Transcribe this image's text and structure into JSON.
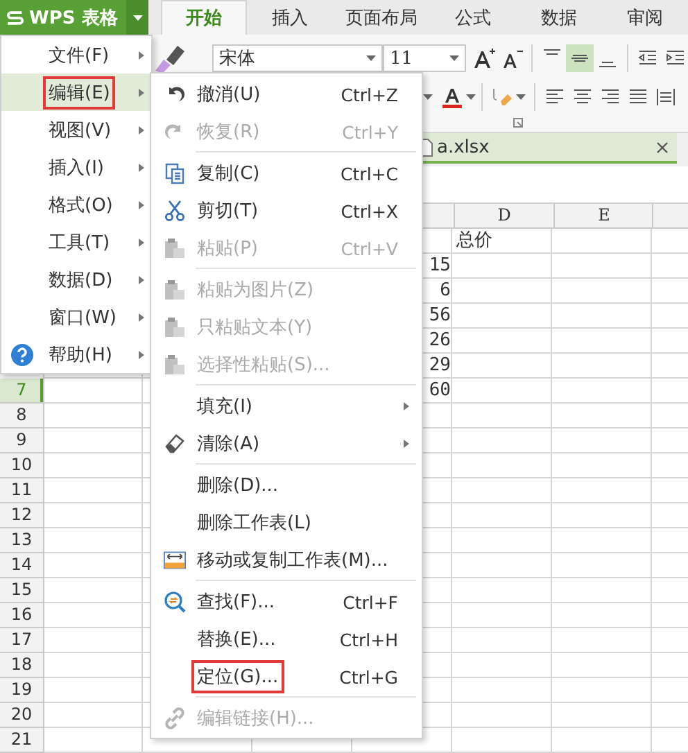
{
  "app_button": {
    "label": "WPS 表格"
  },
  "ribbon_tabs": [
    {
      "label": "开始",
      "selected": true
    },
    {
      "label": "插入",
      "selected": false
    },
    {
      "label": "页面布局",
      "selected": false
    },
    {
      "label": "公式",
      "selected": false
    },
    {
      "label": "数据",
      "selected": false
    },
    {
      "label": "审阅",
      "selected": false
    }
  ],
  "toolbar": {
    "font": "宋体",
    "font_size": "11"
  },
  "document_tab": {
    "title": "a.xlsx"
  },
  "sheet": {
    "column_headers": [
      "D",
      "E"
    ],
    "row_numbers": [
      {
        "label": "7",
        "selected": true
      },
      {
        "label": "8",
        "selected": false
      },
      {
        "label": "9",
        "selected": false
      },
      {
        "label": "10",
        "selected": false
      },
      {
        "label": "11",
        "selected": false
      },
      {
        "label": "12",
        "selected": false
      },
      {
        "label": "13",
        "selected": false
      },
      {
        "label": "14",
        "selected": false
      },
      {
        "label": "15",
        "selected": false
      },
      {
        "label": "16",
        "selected": false
      },
      {
        "label": "17",
        "selected": false
      },
      {
        "label": "18",
        "selected": false
      },
      {
        "label": "19",
        "selected": false
      },
      {
        "label": "20",
        "selected": false
      },
      {
        "label": "21",
        "selected": false
      }
    ],
    "rows": [
      {
        "column_d": "总价"
      },
      {
        "column_c": "15"
      },
      {
        "column_c": "6"
      },
      {
        "column_c": "56"
      },
      {
        "column_c": "26"
      },
      {
        "column_c": "29"
      },
      {
        "column_c": "60"
      }
    ]
  },
  "main_menu": {
    "items": [
      {
        "label": "文件(F)",
        "selected": false,
        "marked": false
      },
      {
        "label": "编辑(E)",
        "selected": true,
        "marked": true
      },
      {
        "label": "视图(V)",
        "selected": false,
        "marked": false
      },
      {
        "label": "插入(I)",
        "selected": false,
        "marked": false
      },
      {
        "label": "格式(O)",
        "selected": false,
        "marked": false
      },
      {
        "label": "工具(T)",
        "selected": false,
        "marked": false
      },
      {
        "label": "数据(D)",
        "selected": false,
        "marked": false
      },
      {
        "label": "窗口(W)",
        "selected": false,
        "marked": false
      },
      {
        "label": "帮助(H)",
        "selected": false,
        "marked": false
      }
    ]
  },
  "edit_menu": {
    "items": [
      {
        "kind": "item",
        "label": "撤消(U)",
        "shortcut": "Ctrl+Z",
        "disabled": false,
        "has_submenu": false,
        "marked": false
      },
      {
        "kind": "item",
        "label": "恢复(R)",
        "shortcut": "Ctrl+Y",
        "disabled": true,
        "has_submenu": false,
        "marked": false
      },
      {
        "kind": "separator"
      },
      {
        "kind": "item",
        "label": "复制(C)",
        "shortcut": "Ctrl+C",
        "disabled": false,
        "has_submenu": false,
        "marked": false
      },
      {
        "kind": "item",
        "label": "剪切(T)",
        "shortcut": "Ctrl+X",
        "disabled": false,
        "has_submenu": false,
        "marked": false
      },
      {
        "kind": "item",
        "label": "粘贴(P)",
        "shortcut": "Ctrl+V",
        "disabled": true,
        "has_submenu": false,
        "marked": false
      },
      {
        "kind": "separator"
      },
      {
        "kind": "item",
        "label": "粘贴为图片(Z)",
        "disabled": true,
        "has_submenu": false,
        "marked": false
      },
      {
        "kind": "item",
        "label": "只粘贴文本(Y)",
        "disabled": true,
        "has_submenu": false,
        "marked": false
      },
      {
        "kind": "item",
        "label": "选择性粘贴(S)...",
        "disabled": true,
        "has_submenu": false,
        "marked": false
      },
      {
        "kind": "separator"
      },
      {
        "kind": "item",
        "label": "填充(I)",
        "disabled": false,
        "has_submenu": true,
        "marked": false
      },
      {
        "kind": "item",
        "label": "清除(A)",
        "disabled": false,
        "has_submenu": true,
        "marked": false
      },
      {
        "kind": "separator"
      },
      {
        "kind": "item",
        "label": "删除(D)...",
        "disabled": false,
        "has_submenu": false,
        "marked": false
      },
      {
        "kind": "item",
        "label": "删除工作表(L)",
        "disabled": false,
        "has_submenu": false,
        "marked": false
      },
      {
        "kind": "item",
        "label": "移动或复制工作表(M)...",
        "disabled": false,
        "has_submenu": false,
        "marked": false
      },
      {
        "kind": "separator"
      },
      {
        "kind": "item",
        "label": "查找(F)...",
        "shortcut": "Ctrl+F",
        "disabled": false,
        "has_submenu": false,
        "marked": false
      },
      {
        "kind": "item",
        "label": "替换(E)...",
        "shortcut": "Ctrl+H",
        "disabled": false,
        "has_submenu": false,
        "marked": false
      },
      {
        "kind": "item",
        "label": "定位(G)...",
        "shortcut": "Ctrl+G",
        "disabled": false,
        "has_submenu": false,
        "marked": true
      },
      {
        "kind": "separator"
      },
      {
        "kind": "item",
        "label": "编辑链接(H)...",
        "disabled": true,
        "has_submenu": false,
        "marked": false
      }
    ]
  }
}
